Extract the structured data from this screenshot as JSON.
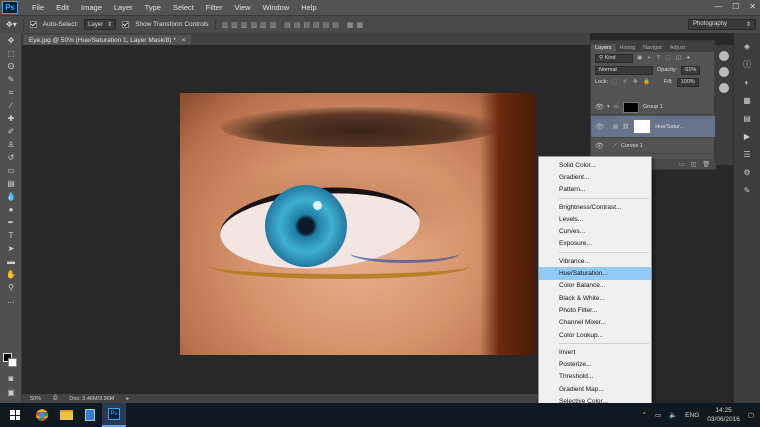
{
  "menubar": {
    "logo": "Ps",
    "items": [
      "File",
      "Edit",
      "Image",
      "Layer",
      "Type",
      "Select",
      "Filter",
      "View",
      "Window",
      "Help"
    ],
    "window_controls": [
      "—",
      "☐",
      "✕"
    ]
  },
  "options_bar": {
    "auto_select_label": "Auto-Select:",
    "auto_select_checked": true,
    "layer_select_value": "Layer",
    "show_transform_label": "Show Transform Controls",
    "show_transform_checked": true,
    "workspace": "Photography"
  },
  "document": {
    "tab_title": "Eye.jpg @ 50% (Hue/Saturation 1, Layer Mask/8) *",
    "tab_close": "×"
  },
  "status_bar": {
    "zoom": "50%",
    "doc_info": "Doc: 3.46M/3.96M"
  },
  "layers_panel": {
    "tabs": [
      "Layers",
      "Histog",
      "Navigat",
      "Adjust"
    ],
    "kind_label": "Kind",
    "blend_mode": "Normal",
    "opacity_label": "Opacity:",
    "opacity_value": "61%",
    "lock_label": "Lock:",
    "fill_label": "Fill:",
    "fill_value": "100%",
    "layers": [
      {
        "name": "Group 1",
        "visible": true,
        "selected": false
      },
      {
        "name": "Hue/Satur...",
        "visible": true,
        "selected": true
      },
      {
        "name": "Curves 1",
        "visible": true,
        "selected": false
      }
    ]
  },
  "adjustment_menu": {
    "groups": [
      [
        "Solid Color...",
        "Gradient...",
        "Pattern..."
      ],
      [
        "Brightness/Contrast...",
        "Levels...",
        "Curves...",
        "Exposure..."
      ],
      [
        "Vibrance...",
        "Hue/Saturation...",
        "Color Balance...",
        "Black & White...",
        "Photo Filter...",
        "Channel Mixer...",
        "Color Lookup..."
      ],
      [
        "Invert",
        "Posterize...",
        "Threshold...",
        "Gradient Map...",
        "Selective Color..."
      ]
    ],
    "highlighted": "Hue/Saturation..."
  },
  "taskbar": {
    "language": "ENG",
    "time": "14:25",
    "date": "03/06/2016"
  }
}
